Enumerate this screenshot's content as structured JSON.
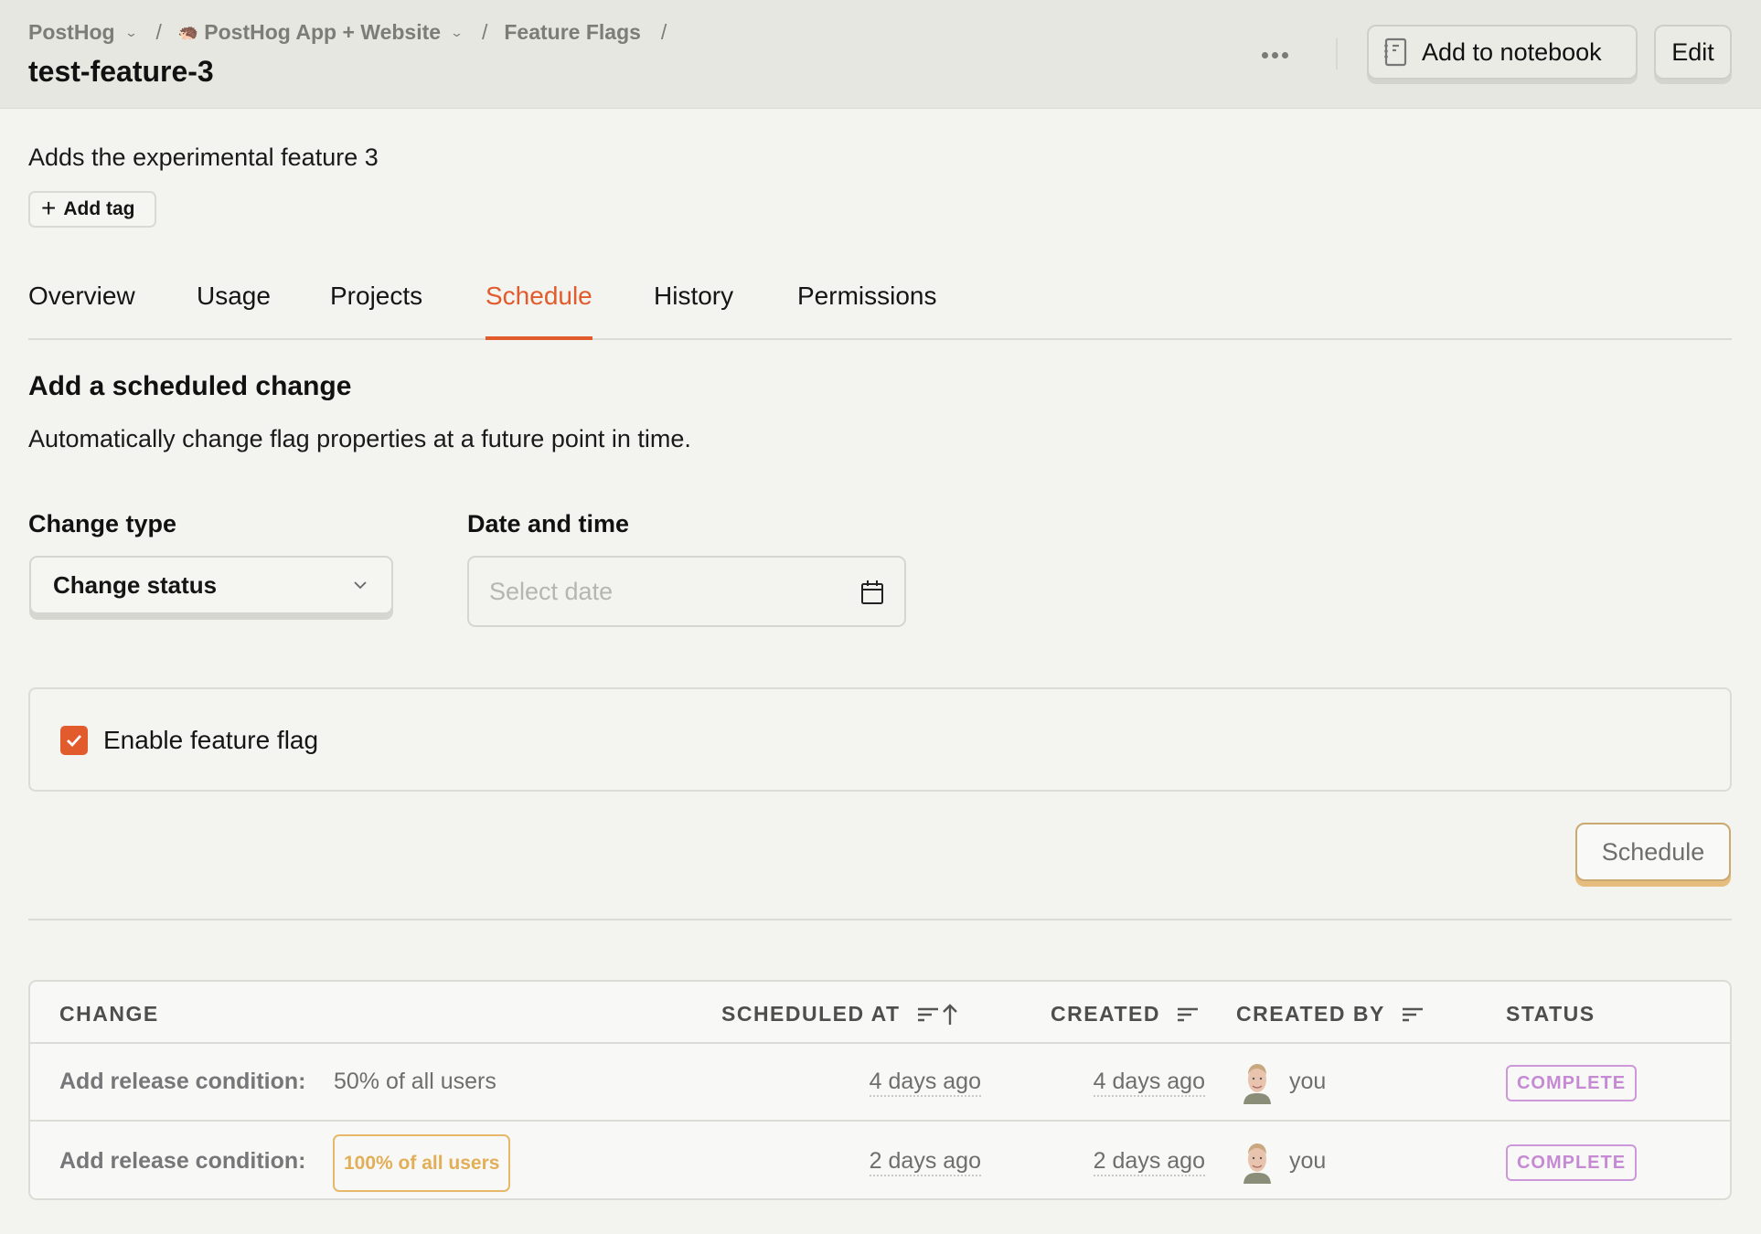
{
  "header": {
    "breadcrumb": [
      {
        "label": "PostHog",
        "has_dropdown": true
      },
      {
        "label": "PostHog App + Website",
        "has_dropdown": true,
        "icon": "hedgehog-icon"
      },
      {
        "label": "Feature Flags",
        "has_dropdown": false
      }
    ],
    "separator": "/",
    "title": "test-feature-3",
    "more_icon": "ellipsis-icon",
    "add_to_notebook_label": "Add to notebook",
    "edit_label": "Edit"
  },
  "flag": {
    "description": "Adds the experimental feature 3",
    "add_tag_label": "Add tag"
  },
  "tabs": [
    {
      "label": "Overview",
      "active": false
    },
    {
      "label": "Usage",
      "active": false
    },
    {
      "label": "Projects",
      "active": false
    },
    {
      "label": "Schedule",
      "active": true
    },
    {
      "label": "History",
      "active": false
    },
    {
      "label": "Permissions",
      "active": false
    }
  ],
  "schedule_form": {
    "title": "Add a scheduled change",
    "subtitle": "Automatically change flag properties at a future point in time.",
    "change_type_label": "Change type",
    "change_type_value": "Change status",
    "date_label": "Date and time",
    "date_placeholder": "Select date",
    "enable_flag_label": "Enable feature flag",
    "enable_flag_checked": true,
    "submit_label": "Schedule"
  },
  "table": {
    "columns": [
      "CHANGE",
      "SCHEDULED AT",
      "CREATED",
      "CREATED BY",
      "STATUS"
    ],
    "rows": [
      {
        "change_label": "Add release condition:",
        "change_value": "50% of all users",
        "change_highlight": false,
        "scheduled_at": "4 days ago",
        "created": "4 days ago",
        "created_by": "you",
        "status": "COMPLETE"
      },
      {
        "change_label": "Add release condition:",
        "change_value": "100% of all users",
        "change_highlight": true,
        "scheduled_at": "2 days ago",
        "created": "2 days ago",
        "created_by": "you",
        "status": "COMPLETE"
      }
    ]
  },
  "colors": {
    "accent": "#e15b2c",
    "status_complete": "#c58ad3",
    "highlight_badge": "#e2ae57",
    "schedule_button_shadow": "#e6bd7e"
  }
}
